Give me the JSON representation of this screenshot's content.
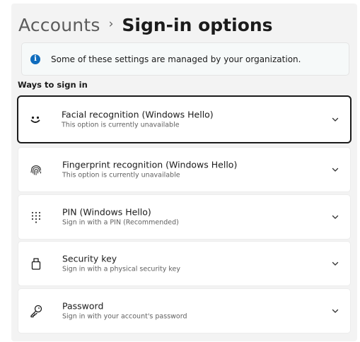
{
  "breadcrumb": {
    "parent": "Accounts",
    "separator": "›",
    "current": "Sign-in options"
  },
  "notice": {
    "icon": "info-icon",
    "icon_glyph": "i",
    "text": "Some of these settings are managed by your organization."
  },
  "section": {
    "heading": "Ways to sign in"
  },
  "options": [
    {
      "icon": "face-icon",
      "title": "Facial recognition (Windows Hello)",
      "subtitle": "This option is currently unavailable",
      "focused": true
    },
    {
      "icon": "fingerprint-icon",
      "title": "Fingerprint recognition (Windows Hello)",
      "subtitle": "This option is currently unavailable"
    },
    {
      "icon": "pin-keypad-icon",
      "title": "PIN (Windows Hello)",
      "subtitle": "Sign in with a PIN (Recommended)"
    },
    {
      "icon": "security-key-icon",
      "title": "Security key",
      "subtitle": "Sign in with a physical security key"
    },
    {
      "icon": "password-key-icon",
      "title": "Password",
      "subtitle": "Sign in with your account's password"
    }
  ],
  "colors": {
    "panel_background": "#f3f3f3",
    "card_background": "#ffffff",
    "focus_border": "#1b1b1b",
    "accent": "#0f6cbd",
    "text_primary": "#1b1b1b",
    "text_secondary": "#5f5f5f"
  }
}
